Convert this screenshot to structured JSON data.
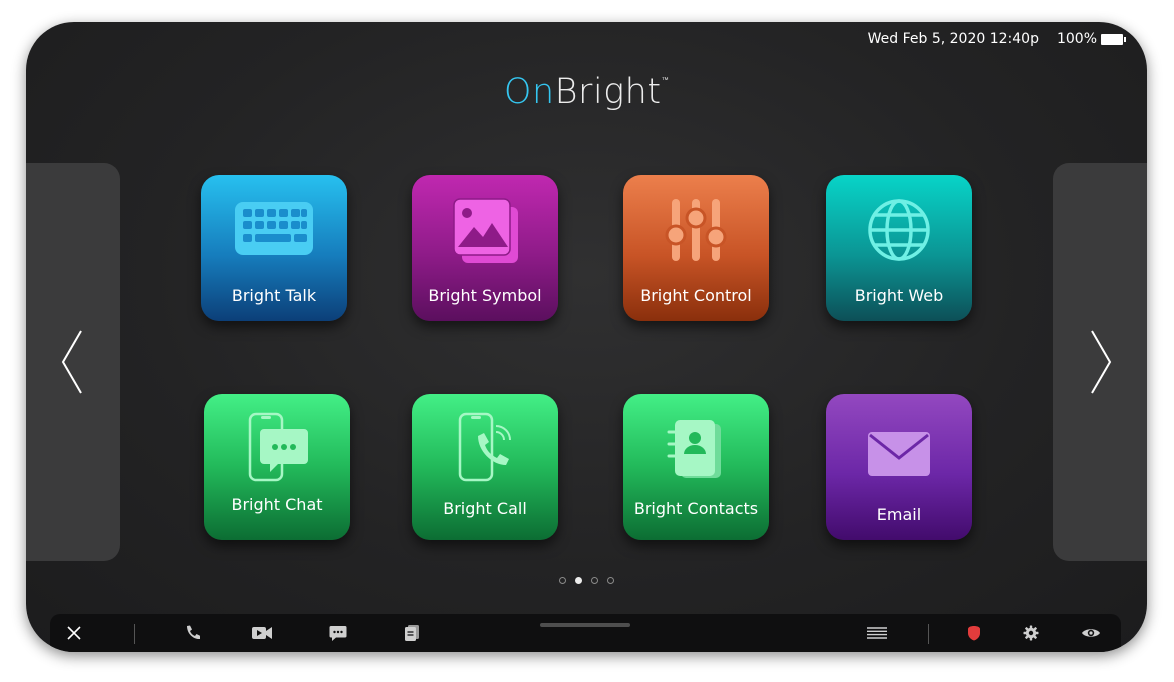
{
  "status": {
    "datetime": "Wed Feb 5, 2020 12:40p",
    "battery": "100%"
  },
  "logo": {
    "on": "On",
    "bright": "Bright",
    "tm": "™"
  },
  "nav": {
    "prev_icon": "chevron-left-icon",
    "next_icon": "chevron-right-icon"
  },
  "apps": [
    {
      "label": "Bright Talk",
      "icon": "keyboard-icon"
    },
    {
      "label": "Bright Symbol",
      "icon": "images-icon"
    },
    {
      "label": "Bright Control",
      "icon": "sliders-icon"
    },
    {
      "label": "Bright Web",
      "icon": "globe-icon"
    },
    {
      "label": "Bright Chat",
      "icon": "phone-chat-icon"
    },
    {
      "label": "Bright Call",
      "icon": "phone-call-icon"
    },
    {
      "label": "Bright Contacts",
      "icon": "contacts-book-icon"
    },
    {
      "label": "Email",
      "icon": "envelope-icon"
    }
  ],
  "pagination": {
    "total": 4,
    "current_index": 1
  },
  "taskbar": {
    "left": [
      "close-icon",
      "phone-icon",
      "video-camera-icon",
      "chat-bubble-icon",
      "document-icon"
    ],
    "right": [
      "keyboard-lines-icon",
      "alert-shield-icon",
      "gear-icon",
      "eye-icon"
    ]
  },
  "colors": {
    "logo_on": "#35c6f0",
    "alert": "#e23c3c",
    "talk": "#167dbd",
    "symbol": "#8e1b88",
    "control": "#c85426",
    "web": "#0b9594",
    "green": "#22b95a",
    "email": "#6c27a7"
  }
}
